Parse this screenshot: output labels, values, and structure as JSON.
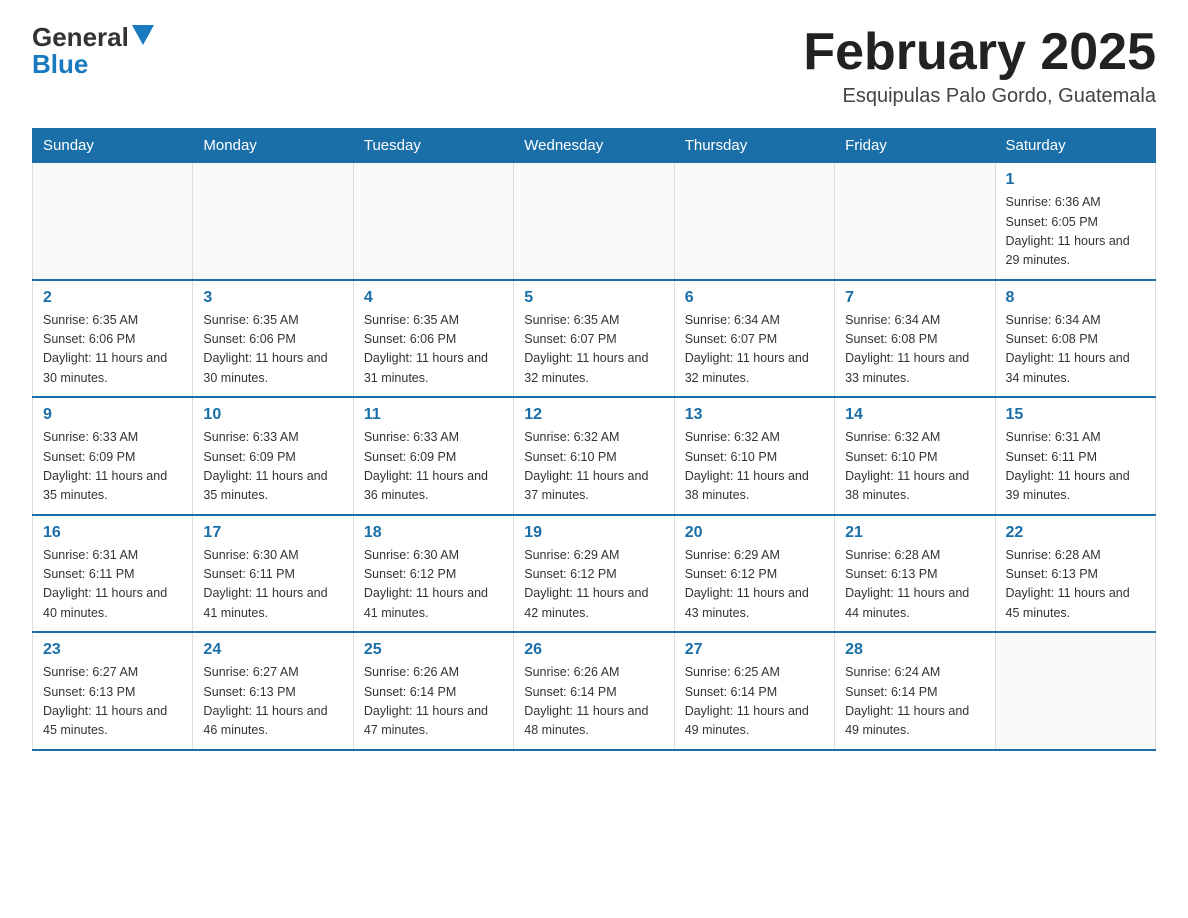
{
  "header": {
    "logo": {
      "general": "General",
      "arrow": "▶",
      "blue": "Blue"
    },
    "title": "February 2025",
    "subtitle": "Esquipulas Palo Gordo, Guatemala"
  },
  "days_of_week": [
    "Sunday",
    "Monday",
    "Tuesday",
    "Wednesday",
    "Thursday",
    "Friday",
    "Saturday"
  ],
  "weeks": [
    {
      "days": [
        {
          "num": "",
          "info": ""
        },
        {
          "num": "",
          "info": ""
        },
        {
          "num": "",
          "info": ""
        },
        {
          "num": "",
          "info": ""
        },
        {
          "num": "",
          "info": ""
        },
        {
          "num": "",
          "info": ""
        },
        {
          "num": "1",
          "info": "Sunrise: 6:36 AM\nSunset: 6:05 PM\nDaylight: 11 hours and 29 minutes."
        }
      ]
    },
    {
      "days": [
        {
          "num": "2",
          "info": "Sunrise: 6:35 AM\nSunset: 6:06 PM\nDaylight: 11 hours and 30 minutes."
        },
        {
          "num": "3",
          "info": "Sunrise: 6:35 AM\nSunset: 6:06 PM\nDaylight: 11 hours and 30 minutes."
        },
        {
          "num": "4",
          "info": "Sunrise: 6:35 AM\nSunset: 6:06 PM\nDaylight: 11 hours and 31 minutes."
        },
        {
          "num": "5",
          "info": "Sunrise: 6:35 AM\nSunset: 6:07 PM\nDaylight: 11 hours and 32 minutes."
        },
        {
          "num": "6",
          "info": "Sunrise: 6:34 AM\nSunset: 6:07 PM\nDaylight: 11 hours and 32 minutes."
        },
        {
          "num": "7",
          "info": "Sunrise: 6:34 AM\nSunset: 6:08 PM\nDaylight: 11 hours and 33 minutes."
        },
        {
          "num": "8",
          "info": "Sunrise: 6:34 AM\nSunset: 6:08 PM\nDaylight: 11 hours and 34 minutes."
        }
      ]
    },
    {
      "days": [
        {
          "num": "9",
          "info": "Sunrise: 6:33 AM\nSunset: 6:09 PM\nDaylight: 11 hours and 35 minutes."
        },
        {
          "num": "10",
          "info": "Sunrise: 6:33 AM\nSunset: 6:09 PM\nDaylight: 11 hours and 35 minutes."
        },
        {
          "num": "11",
          "info": "Sunrise: 6:33 AM\nSunset: 6:09 PM\nDaylight: 11 hours and 36 minutes."
        },
        {
          "num": "12",
          "info": "Sunrise: 6:32 AM\nSunset: 6:10 PM\nDaylight: 11 hours and 37 minutes."
        },
        {
          "num": "13",
          "info": "Sunrise: 6:32 AM\nSunset: 6:10 PM\nDaylight: 11 hours and 38 minutes."
        },
        {
          "num": "14",
          "info": "Sunrise: 6:32 AM\nSunset: 6:10 PM\nDaylight: 11 hours and 38 minutes."
        },
        {
          "num": "15",
          "info": "Sunrise: 6:31 AM\nSunset: 6:11 PM\nDaylight: 11 hours and 39 minutes."
        }
      ]
    },
    {
      "days": [
        {
          "num": "16",
          "info": "Sunrise: 6:31 AM\nSunset: 6:11 PM\nDaylight: 11 hours and 40 minutes."
        },
        {
          "num": "17",
          "info": "Sunrise: 6:30 AM\nSunset: 6:11 PM\nDaylight: 11 hours and 41 minutes."
        },
        {
          "num": "18",
          "info": "Sunrise: 6:30 AM\nSunset: 6:12 PM\nDaylight: 11 hours and 41 minutes."
        },
        {
          "num": "19",
          "info": "Sunrise: 6:29 AM\nSunset: 6:12 PM\nDaylight: 11 hours and 42 minutes."
        },
        {
          "num": "20",
          "info": "Sunrise: 6:29 AM\nSunset: 6:12 PM\nDaylight: 11 hours and 43 minutes."
        },
        {
          "num": "21",
          "info": "Sunrise: 6:28 AM\nSunset: 6:13 PM\nDaylight: 11 hours and 44 minutes."
        },
        {
          "num": "22",
          "info": "Sunrise: 6:28 AM\nSunset: 6:13 PM\nDaylight: 11 hours and 45 minutes."
        }
      ]
    },
    {
      "days": [
        {
          "num": "23",
          "info": "Sunrise: 6:27 AM\nSunset: 6:13 PM\nDaylight: 11 hours and 45 minutes."
        },
        {
          "num": "24",
          "info": "Sunrise: 6:27 AM\nSunset: 6:13 PM\nDaylight: 11 hours and 46 minutes."
        },
        {
          "num": "25",
          "info": "Sunrise: 6:26 AM\nSunset: 6:14 PM\nDaylight: 11 hours and 47 minutes."
        },
        {
          "num": "26",
          "info": "Sunrise: 6:26 AM\nSunset: 6:14 PM\nDaylight: 11 hours and 48 minutes."
        },
        {
          "num": "27",
          "info": "Sunrise: 6:25 AM\nSunset: 6:14 PM\nDaylight: 11 hours and 49 minutes."
        },
        {
          "num": "28",
          "info": "Sunrise: 6:24 AM\nSunset: 6:14 PM\nDaylight: 11 hours and 49 minutes."
        },
        {
          "num": "",
          "info": ""
        }
      ]
    }
  ]
}
